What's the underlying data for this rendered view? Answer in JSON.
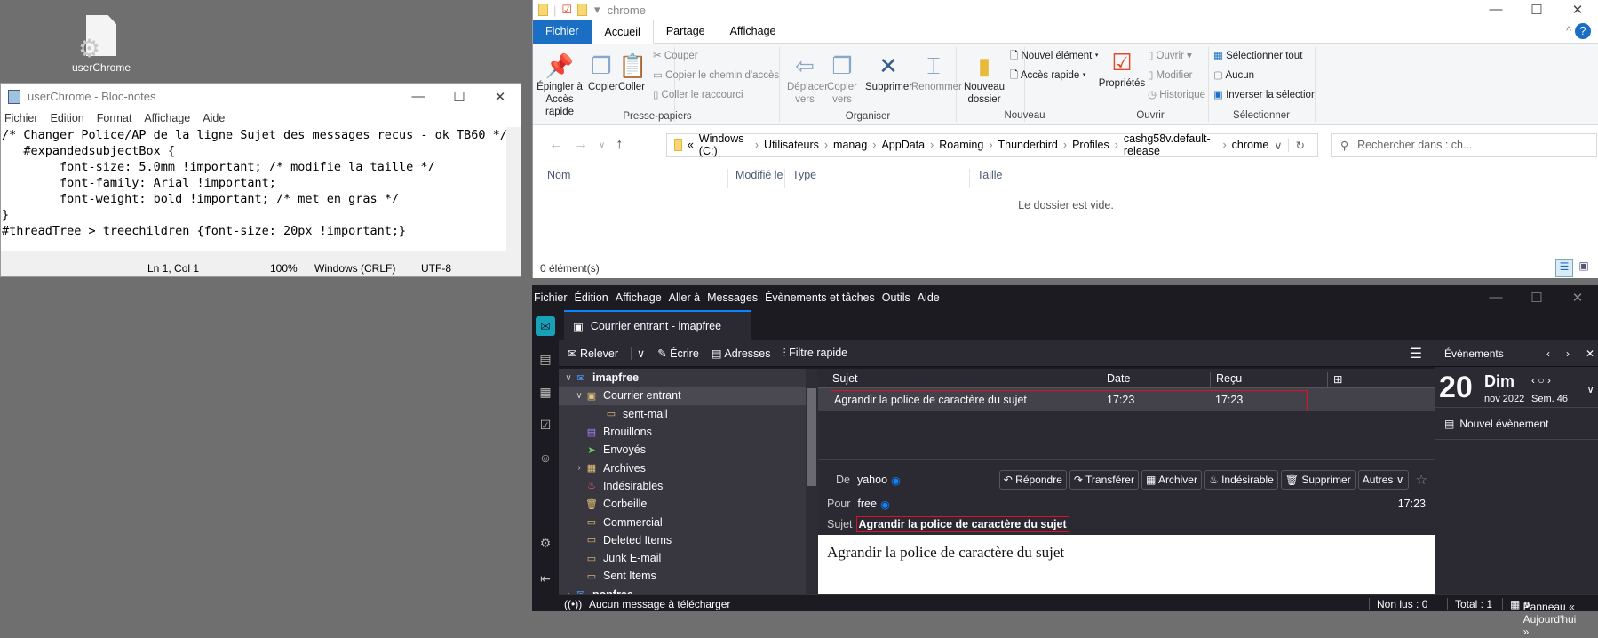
{
  "desktop": {
    "icon_label": "userChrome"
  },
  "notepad": {
    "title": "userChrome - Bloc-notes",
    "menu": [
      "Fichier",
      "Edition",
      "Format",
      "Affichage",
      "Aide"
    ],
    "lines": [
      "/* Changer Police/AP de la ligne Sujet des messages recus - ok TB60 */",
      "   #expandedsubjectBox {",
      "        font-size: 5.0mm !important; /* modifie la taille */",
      "        font-family: Arial !important;",
      "        font-weight: bold !important; /* met en gras */",
      "}",
      "#threadTree > treechildren {font-size: 20px !important;}"
    ],
    "status": {
      "position": "Ln 1, Col 1",
      "zoom": "100%",
      "eol": "Windows (CRLF)",
      "encoding": "UTF-8"
    }
  },
  "explorer": {
    "title": "chrome",
    "tabs": [
      "Fichier",
      "Accueil",
      "Partage",
      "Affichage"
    ],
    "ribbon": {
      "pin": "Épingler à Accès rapide",
      "copy": "Copier",
      "paste": "Coller",
      "cut": "Couper",
      "copy_path": "Copier le chemin d'accès",
      "paste_shortcut": "Coller le raccourci",
      "group_clipboard": "Presse-papiers",
      "move_to": "Déplacer vers",
      "copy_to": "Copier vers",
      "delete": "Supprimer",
      "rename": "Renommer",
      "group_organize": "Organiser",
      "new_folder": "Nouveau dossier",
      "new_item": "Nouvel élément",
      "quick_access": "Accès rapide",
      "group_new": "Nouveau",
      "properties": "Propriétés",
      "open": "Ouvrir",
      "edit": "Modifier",
      "history": "Historique",
      "group_open": "Ouvrir",
      "select_all": "Sélectionner tout",
      "select_none": "Aucun",
      "invert": "Inverser la sélection",
      "group_select": "Sélectionner"
    },
    "path": [
      "Windows (C:)",
      "Utilisateurs",
      "manag",
      "AppData",
      "Roaming",
      "Thunderbird",
      "Profiles",
      "cashg58v.default-release",
      "chrome"
    ],
    "search_placeholder": "Rechercher dans : ch...",
    "columns": [
      "Nom",
      "Modifié le",
      "Type",
      "Taille"
    ],
    "empty_text": "Le dossier est vide.",
    "status": "0 élément(s)"
  },
  "thunderbird": {
    "menu": [
      "Fichier",
      "Édition",
      "Affichage",
      "Aller à",
      "Messages",
      "Évènements et tâches",
      "Outils",
      "Aide"
    ],
    "tab": "Courrier entrant - imapfree",
    "toolbar": {
      "get": "Relever",
      "write": "Écrire",
      "address": "Adresses",
      "filter": "Filtre rapide"
    },
    "folders": [
      {
        "name": "imapfree",
        "icon": "✉",
        "level": 0,
        "chevron": "∨"
      },
      {
        "name": "Courrier entrant",
        "icon": "▣",
        "level": 1,
        "chevron": "∨"
      },
      {
        "name": "sent-mail",
        "icon": "▭",
        "level": 2,
        "chevron": ""
      },
      {
        "name": "Brouillons",
        "icon": "▤",
        "level": 1,
        "chevron": ""
      },
      {
        "name": "Envoyés",
        "icon": "➤",
        "level": 1,
        "chevron": ""
      },
      {
        "name": "Archives",
        "icon": "▦",
        "level": 1,
        "chevron": "›"
      },
      {
        "name": "Indésirables",
        "icon": "♨",
        "level": 1,
        "chevron": ""
      },
      {
        "name": "Corbeille",
        "icon": "🗑",
        "level": 1,
        "chevron": ""
      },
      {
        "name": "Commercial",
        "icon": "▭",
        "level": 1,
        "chevron": ""
      },
      {
        "name": "Deleted Items",
        "icon": "▭",
        "level": 1,
        "chevron": ""
      },
      {
        "name": "Junk E-mail",
        "icon": "▭",
        "level": 1,
        "chevron": ""
      },
      {
        "name": "Sent Items",
        "icon": "▭",
        "level": 1,
        "chevron": ""
      },
      {
        "name": "popfree",
        "icon": "✉",
        "level": 0,
        "chevron": "›"
      }
    ],
    "columns": [
      "Sujet",
      "Date",
      "Reçu"
    ],
    "message": {
      "subject": "Agrandir la police de caractère du sujet",
      "date": "17:23",
      "received": "17:23"
    },
    "header": {
      "from_label": "De",
      "from": "yahoo",
      "to_label": "Pour",
      "to": "free",
      "time": "17:23",
      "subject_label": "Sujet",
      "subject": "Agrandir la police de caractère du sujet",
      "buttons": [
        "Répondre",
        "Transférer",
        "Archiver",
        "Indésirable",
        "Supprimer",
        "Autres"
      ]
    },
    "body": "Agrandir la police de caractère du sujet",
    "events": {
      "title": "Évènements",
      "day": "20",
      "weekday": "Dim",
      "month": "nov 2022",
      "week": "Sem. 46",
      "new_event": "Nouvel évènement"
    },
    "status": {
      "text": "Aucun message à télécharger",
      "unread": "Non lus : 0",
      "total": "Total : 1",
      "today_pane": "Panneau « Aujourd'hui »"
    }
  }
}
